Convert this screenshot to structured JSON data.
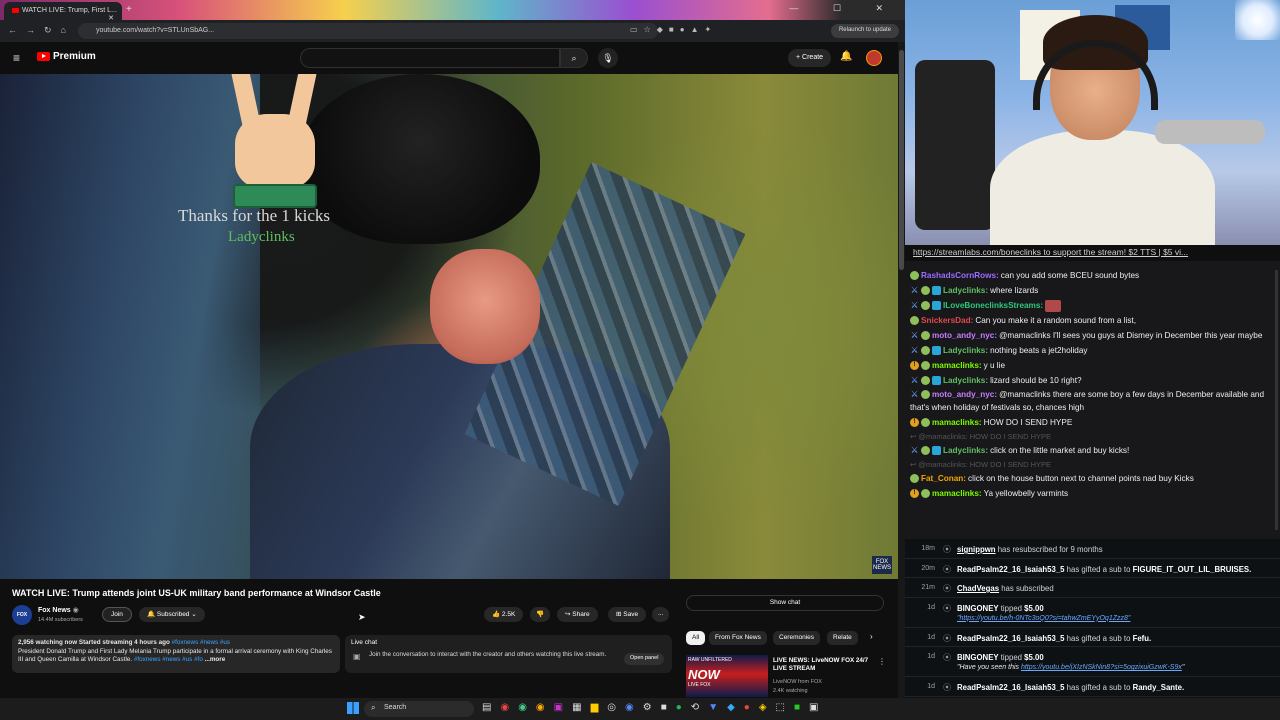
{
  "browser": {
    "tab_title": "WATCH LIVE: Trump, First L...",
    "new_tab": "+",
    "window_controls": "— ☐ ✕",
    "url": "youtube.com/watch?v=STLUnSbAG...",
    "relaunch": "Relaunch to update"
  },
  "youtube": {
    "logo": "Premium",
    "create_label": "Create",
    "video": {
      "overlay_kicks": "Thanks for the 1 kicks",
      "overlay_user": "Ladyclinks",
      "fox_bug": "FOX NEWS",
      "title": "WATCH LIVE: Trump attends joint US-UK military band performance at Windsor Castle",
      "channel": "Fox News",
      "subs": "14.4M subscribers",
      "join": "Join",
      "subscribed": "Subscribed",
      "likes": "2.5K",
      "share": "Share",
      "save": "Save",
      "more": "...",
      "desc_stats": "2,956 watching now  Started streaming 4 hours ago",
      "desc_tags": "#foxnews #news #us",
      "desc_text": "President Donald Trump and First Lady Melania Trump participate in a formal arrival ceremony with King Charles III and Queen Camilla at Windsor Castle.",
      "desc_tags2": "#foxnews #news #us #fo",
      "desc_more": "...more"
    },
    "live_chat": {
      "title": "Live chat",
      "text": "Join the conversation to interact with the creator and others watching this live stream.",
      "open_panel": "Open panel"
    },
    "show_chat": "Show chat",
    "chips": [
      "All",
      "From Fox News",
      "Ceremonies",
      "Relate"
    ],
    "recommended": {
      "thumb_top": "RAW UNFILTERED",
      "thumb_text": "NOW",
      "thumb_bottom": "LIVE FOX",
      "title": "LIVE NEWS: LiveNOW FOX 24/7 LIVE STREAM",
      "channel": "LiveNOW from FOX",
      "meta": "2.4K watching"
    }
  },
  "stream": {
    "url_banner": "https://streamlabs.com/boneclinks to support the stream! $2 TTS | $5 vi..."
  },
  "chat": [
    {
      "badges": [
        "round"
      ],
      "user": "RashadsCornRows:",
      "color": "#9b6cff",
      "text": "can you add some BCEU sound bytes"
    },
    {
      "badges": [
        "sword",
        "round",
        "gem"
      ],
      "user": "Ladyclinks:",
      "color": "#5fbf62",
      "text": "where lizards"
    },
    {
      "badges": [
        "sword",
        "round",
        "gem"
      ],
      "user": "ILoveBoneclinksStreams:",
      "color": "#2fc77a",
      "text": "",
      "emote": true
    },
    {
      "badges": [
        "round"
      ],
      "user": "SnickersDad:",
      "color": "#e04a4a",
      "text": "Can you make it a random sound from a list,"
    },
    {
      "badges": [
        "sword",
        "round"
      ],
      "user": "moto_andy_nyc:",
      "color": "#c77dff",
      "text": "@mamaclinks I'll sees you guys at Dismey in December this year maybe"
    },
    {
      "badges": [
        "sword",
        "round",
        "gem"
      ],
      "user": "Ladyclinks:",
      "color": "#5fbf62",
      "text": "nothing beats a jet2holiday"
    },
    {
      "badges": [
        "gold",
        "round"
      ],
      "user": "mamaclinks:",
      "color": "#7cfc00",
      "text": "y u lie"
    },
    {
      "badges": [
        "sword",
        "round",
        "gem"
      ],
      "user": "Ladyclinks:",
      "color": "#5fbf62",
      "text": "lizard should be 10 right?"
    },
    {
      "badges": [
        "sword",
        "round"
      ],
      "user": "moto_andy_nyc:",
      "color": "#c77dff",
      "text": "@mamaclinks there are some boy a few days in December available and that's when holiday of festivals so, chances high",
      "wrap": true
    },
    {
      "badges": [
        "gold",
        "round"
      ],
      "user": "mamaclinks:",
      "color": "#7cfc00",
      "text": "HOW DO I SEND HYPE"
    },
    {
      "cmd": true,
      "text": "↩ @mamaclinks: HOW DO I SEND HYPE"
    },
    {
      "badges": [
        "sword",
        "round",
        "gem"
      ],
      "user": "Ladyclinks:",
      "color": "#5fbf62",
      "text": "click on the little market and buy kicks!"
    },
    {
      "cmd": true,
      "text": "↩ @mamaclinks: HOW DO I SEND HYPE"
    },
    {
      "badges": [
        "round"
      ],
      "user": "Fat_Conan:",
      "color": "#f0a500",
      "text": "click on the house button next to channel points nad buy Kicks"
    },
    {
      "badges": [
        "gold",
        "round"
      ],
      "user": "mamaclinks:",
      "color": "#7cfc00",
      "text": "Ya yellowbelly varmints"
    }
  ],
  "events": [
    {
      "ago": "18m",
      "icon": "k",
      "user": "signippwn",
      "underline": true,
      "text": " has resubscribed for 9 months"
    },
    {
      "ago": "20m",
      "icon": "k",
      "user": "ReadPsalm22_16_Isaiah53_5",
      "text": " has gifted a sub to ",
      "target": "FIGURE_IT_OUT_LIL_BRUISES."
    },
    {
      "ago": "21m",
      "icon": "k",
      "user": "ChadVegas",
      "underline": true,
      "text": " has subscribed"
    },
    {
      "ago": "1d",
      "icon": "k",
      "user": "BINGONEY",
      "text": " tipped ",
      "amount": "$5.00",
      "note_link": "\"https://youtu.be/h-0NTc3oQ0?si=tahwZmEYyOq1Zzz8\""
    },
    {
      "ago": "1d",
      "icon": "k",
      "user": "ReadPsalm22_16_Isaiah53_5",
      "text": " has gifted a sub to ",
      "target": "Fefu."
    },
    {
      "ago": "1d",
      "icon": "k",
      "user": "BINGONEY",
      "text": " tipped ",
      "amount": "$5.00",
      "note_pre": "\"Have you seen this ",
      "note_link2": "https://youtu.be/jXIzNSkNin8?si=5ogzixuiGzwK-S9x",
      "note_post": "\""
    },
    {
      "ago": "1d",
      "icon": "k",
      "user": "ReadPsalm22_16_Isaiah53_5",
      "text": " has gifted a sub to ",
      "target": "Randy_Sante."
    },
    {
      "ago": "1d",
      "icon": "k",
      "user": "BINGONEY",
      "text": " tipped ",
      "amount": "$5.00"
    }
  ],
  "taskbar": {
    "search": "Search"
  }
}
